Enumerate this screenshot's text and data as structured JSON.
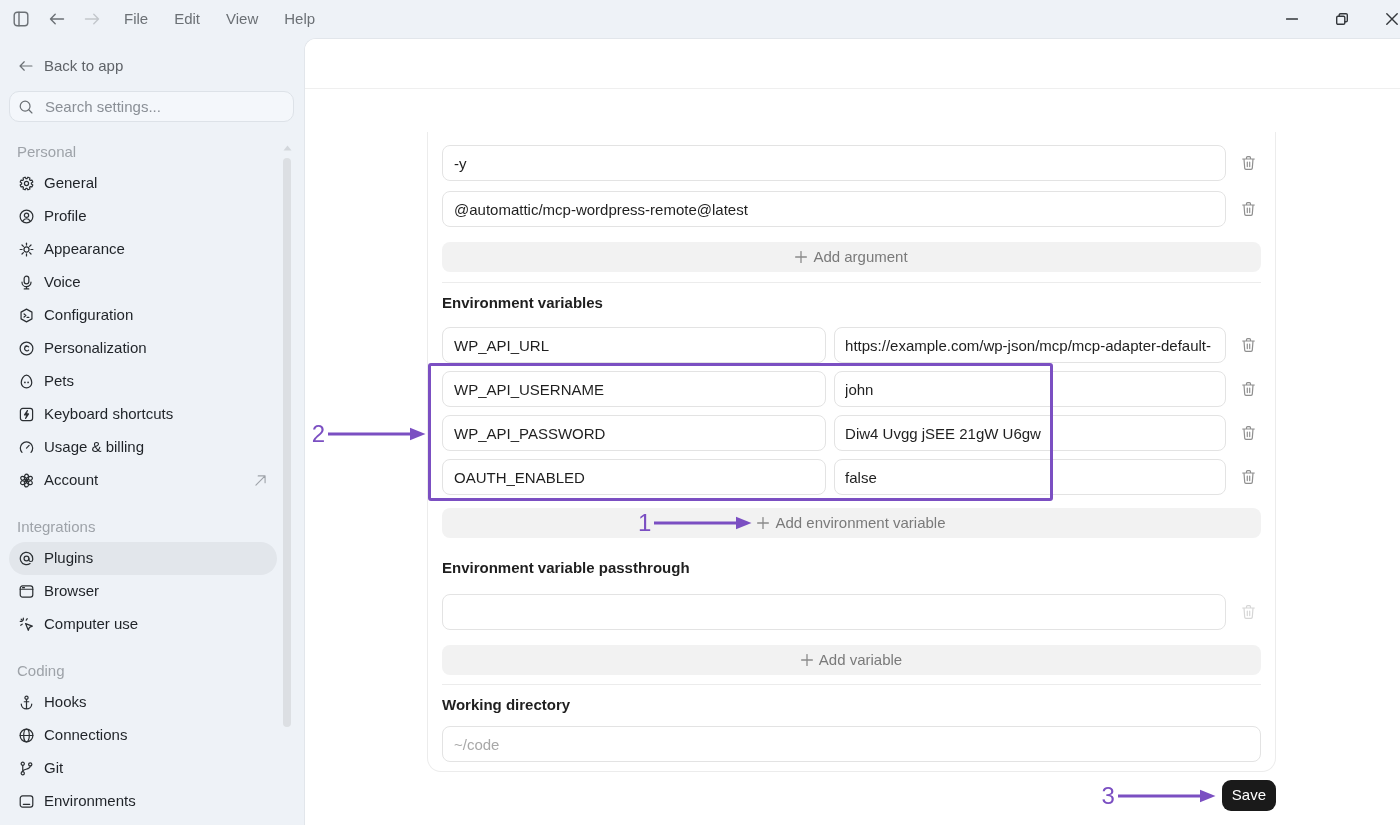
{
  "title_bar": {
    "navigation": [
      {
        "kind": "back",
        "disabled": false
      },
      {
        "kind": "forward",
        "disabled": true
      }
    ],
    "menu": [
      "File",
      "Edit",
      "View",
      "Help"
    ]
  },
  "sidebar": {
    "back_link": "Back to app",
    "search": {
      "placeholder": "Search settings..."
    },
    "sections": [
      {
        "title": "Personal",
        "items": [
          {
            "label": "General",
            "selected": false,
            "external": false
          },
          {
            "label": "Profile",
            "selected": false,
            "external": false
          },
          {
            "label": "Appearance",
            "selected": false,
            "external": false
          },
          {
            "label": "Voice",
            "selected": false,
            "external": false
          },
          {
            "label": "Configuration",
            "selected": false,
            "external": false
          },
          {
            "label": "Personalization",
            "selected": false,
            "external": false
          },
          {
            "label": "Pets",
            "selected": false,
            "external": false
          },
          {
            "label": "Keyboard shortcuts",
            "selected": false,
            "external": false
          },
          {
            "label": "Usage & billing",
            "selected": false,
            "external": false
          },
          {
            "label": "Account",
            "selected": false,
            "external": true
          }
        ]
      },
      {
        "title": "Integrations",
        "items": [
          {
            "label": "Plugins",
            "selected": true,
            "external": false
          },
          {
            "label": "Browser",
            "selected": false,
            "external": false
          },
          {
            "label": "Computer use",
            "selected": false,
            "external": false
          }
        ]
      },
      {
        "title": "Coding",
        "items": [
          {
            "label": "Hooks",
            "selected": false,
            "external": false
          },
          {
            "label": "Connections",
            "selected": false,
            "external": false
          },
          {
            "label": "Git",
            "selected": false,
            "external": false
          },
          {
            "label": "Environments",
            "selected": false,
            "external": false
          }
        ]
      }
    ]
  },
  "settings_form": {
    "arguments": {
      "rows": [
        {
          "value": "-y",
          "delete_disabled": false
        },
        {
          "value": "@automattic/mcp-wordpress-remote@latest",
          "delete_disabled": false
        }
      ],
      "add_button": {
        "label": "Add argument"
      }
    },
    "environment_variables": {
      "title": "Environment variables",
      "rows": [
        {
          "key": "WP_API_URL",
          "value": "https://example.com/wp-json/mcp/mcp-adapter-default-",
          "delete_disabled": false,
          "highlighted": false
        },
        {
          "key": "WP_API_USERNAME",
          "value": "john",
          "delete_disabled": false,
          "highlighted": true
        },
        {
          "key": "WP_API_PASSWORD",
          "value": "Diw4 Uvgg jSEE 21gW U6gw",
          "delete_disabled": false,
          "highlighted": true
        },
        {
          "key": "OAUTH_ENABLED",
          "value": "false",
          "delete_disabled": false,
          "highlighted": true
        }
      ],
      "highlight_callout": "2",
      "add_button": {
        "label": "Add environment variable",
        "callout": "1"
      }
    },
    "env_passthrough": {
      "title": "Environment variable passthrough",
      "rows": [
        {
          "delete_disabled": true
        }
      ],
      "add_button": {
        "label": "Add variable"
      }
    },
    "working_directory": {
      "title": "Working directory",
      "field": {
        "placeholder": "~/code"
      }
    }
  },
  "save_button": {
    "label": "Save",
    "callout": "3"
  }
}
